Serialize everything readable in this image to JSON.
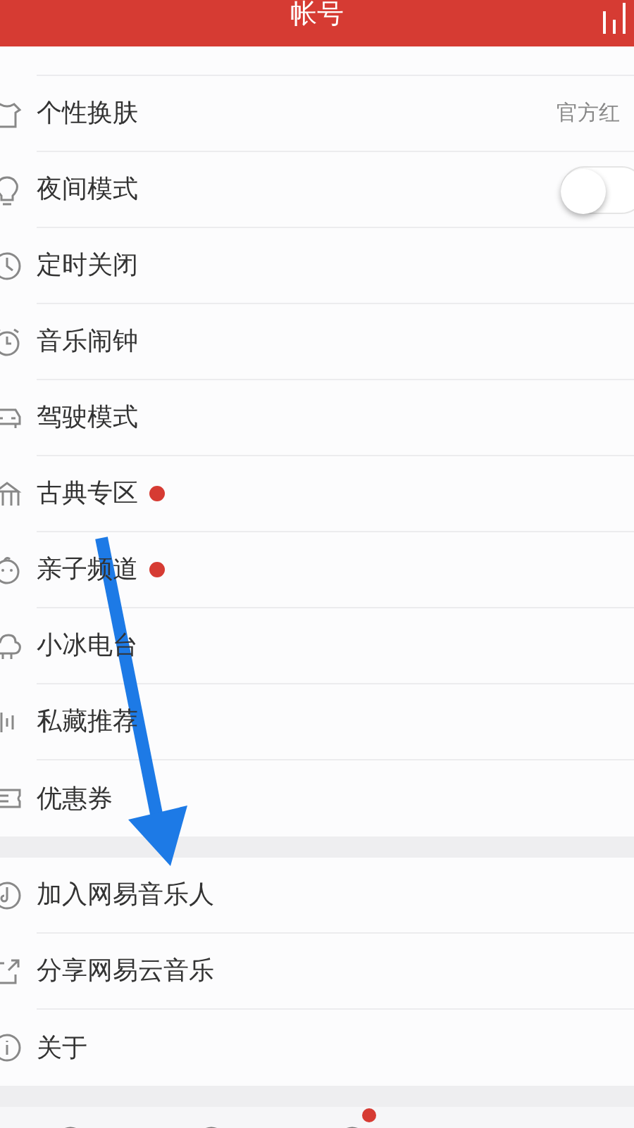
{
  "header": {
    "title": "帐号"
  },
  "sections": [
    {
      "items": [
        {
          "label": "个性换肤",
          "kind": "value",
          "value": "官方红",
          "badge": false
        },
        {
          "label": "夜间模式",
          "kind": "toggle",
          "on": false,
          "badge": false
        },
        {
          "label": "定时关闭",
          "kind": "plain",
          "badge": false
        },
        {
          "label": "音乐闹钟",
          "kind": "plain",
          "badge": false
        },
        {
          "label": "驾驶模式",
          "kind": "plain",
          "badge": false
        },
        {
          "label": "古典专区",
          "kind": "plain",
          "badge": true
        },
        {
          "label": "亲子频道",
          "kind": "plain",
          "badge": true
        },
        {
          "label": "小冰电台",
          "kind": "plain",
          "badge": false
        },
        {
          "label": "私藏推荐",
          "kind": "plain",
          "badge": false
        },
        {
          "label": "优惠券",
          "kind": "plain",
          "badge": false
        }
      ]
    },
    {
      "items": [
        {
          "label": "加入网易音乐人",
          "kind": "plain",
          "badge": false
        },
        {
          "label": "分享网易云音乐",
          "kind": "plain",
          "badge": false
        },
        {
          "label": "关于",
          "kind": "plain",
          "badge": false
        }
      ]
    }
  ],
  "tab_bar": [
    {
      "badge": false
    },
    {
      "badge": false
    },
    {
      "badge": true
    }
  ]
}
